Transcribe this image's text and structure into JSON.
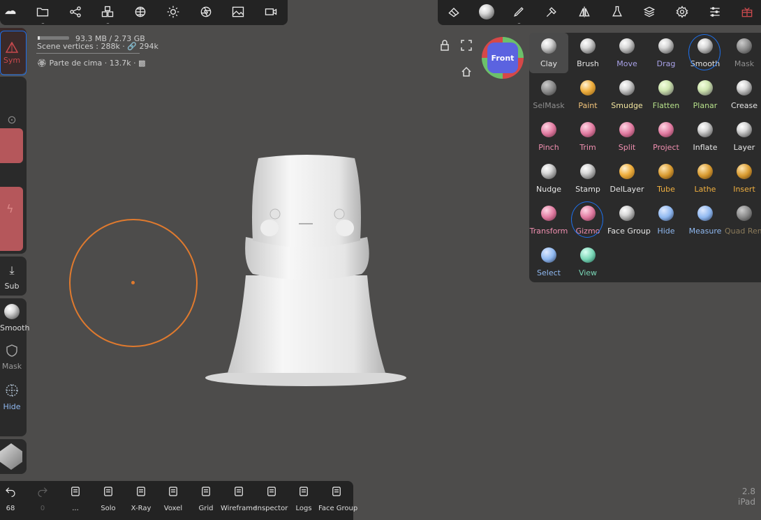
{
  "top_left_toolbar": {
    "icons": [
      "cloud-icon",
      "folder-icon",
      "share-icon",
      "cubes-icon",
      "grid-sphere-icon",
      "sun-icon",
      "aperture-icon",
      "image-icon",
      "video-icon"
    ]
  },
  "top_right_toolbar": {
    "icons": [
      "eraser-cube-icon",
      "material-sphere-icon",
      "brush-icon",
      "hammer-icon",
      "mirror-icon",
      "flask-icon",
      "layers-icon",
      "gear-icon",
      "sliders-icon",
      "gift-icon"
    ]
  },
  "scene_info": {
    "memory": "93.3 MB / 2.73 GB",
    "vertices": "Scene vertices : 288k · 🔗 294k",
    "object": "Parte de cima · 13.7k ·"
  },
  "navigation": {
    "view_cube_label": "Front"
  },
  "left_panel": {
    "sym_label": "Sym",
    "sub_label": "Sub",
    "smooth_label": "Smooth",
    "mask_label": "Mask",
    "hide_label": "Hide"
  },
  "tools": [
    {
      "label": "Clay",
      "color": "#e6e6e6",
      "selected": true
    },
    {
      "label": "Brush",
      "color": "#e6e6e6"
    },
    {
      "label": "Move",
      "color": "#a9a2e8"
    },
    {
      "label": "Drag",
      "color": "#a9a2e8"
    },
    {
      "label": "Smooth",
      "color": "#e6e6e6",
      "annotated": true
    },
    {
      "label": "Mask",
      "color": "#8f8f8f"
    },
    {
      "label": "SelMask",
      "color": "#8f8f8f"
    },
    {
      "label": "Paint",
      "color": "#f3c47a"
    },
    {
      "label": "Smudge",
      "color": "#f3e6a0"
    },
    {
      "label": "Flatten",
      "color": "#b6e08a"
    },
    {
      "label": "Planar",
      "color": "#b6e08a"
    },
    {
      "label": "Crease",
      "color": "#e6e6e6"
    },
    {
      "label": "Pinch",
      "color": "#f08fb0"
    },
    {
      "label": "Trim",
      "color": "#f08fb0"
    },
    {
      "label": "Split",
      "color": "#f08fb0"
    },
    {
      "label": "Project",
      "color": "#f08fb0"
    },
    {
      "label": "Inflate",
      "color": "#e6e6e6"
    },
    {
      "label": "Layer",
      "color": "#e6e6e6"
    },
    {
      "label": "Nudge",
      "color": "#e6e6e6"
    },
    {
      "label": "Stamp",
      "color": "#e6e6e6"
    },
    {
      "label": "DelLayer",
      "color": "#e6e6e6"
    },
    {
      "label": "Tube",
      "color": "#f0b040"
    },
    {
      "label": "Lathe",
      "color": "#f0b040"
    },
    {
      "label": "Insert",
      "color": "#f0b040"
    },
    {
      "label": "Transform",
      "color": "#f08fb0"
    },
    {
      "label": "Gizmo",
      "color": "#f08fb0",
      "annotated": true
    },
    {
      "label": "Face Group",
      "color": "#e6e6e6"
    },
    {
      "label": "Hide",
      "color": "#8fb8f0"
    },
    {
      "label": "Measure",
      "color": "#8fb8f0"
    },
    {
      "label": "Quad Remesher",
      "color": "#8a7a5a"
    },
    {
      "label": "Select",
      "color": "#8fb8f0"
    },
    {
      "label": "View",
      "color": "#7ad6b6"
    }
  ],
  "bottom_toolbar": {
    "undo_count": "68",
    "redo_count": "0",
    "items": [
      {
        "label": "...",
        "icon": "document-icon"
      },
      {
        "label": "Solo",
        "icon": "magnifier-icon"
      },
      {
        "label": "X-Ray",
        "icon": "xray-glasses-icon"
      },
      {
        "label": "Voxel",
        "icon": "voxel-cubes-icon"
      },
      {
        "label": "Grid",
        "icon": "grid-icon"
      },
      {
        "label": "Wireframe",
        "icon": "wireframe-sphere-icon"
      },
      {
        "label": "Inspector",
        "icon": "inspector-icon"
      },
      {
        "label": "Logs",
        "icon": "bug-icon"
      },
      {
        "label": "Face Group",
        "icon": "face-group-icon"
      }
    ]
  },
  "version": {
    "number": "2.8",
    "device": "iPad"
  }
}
